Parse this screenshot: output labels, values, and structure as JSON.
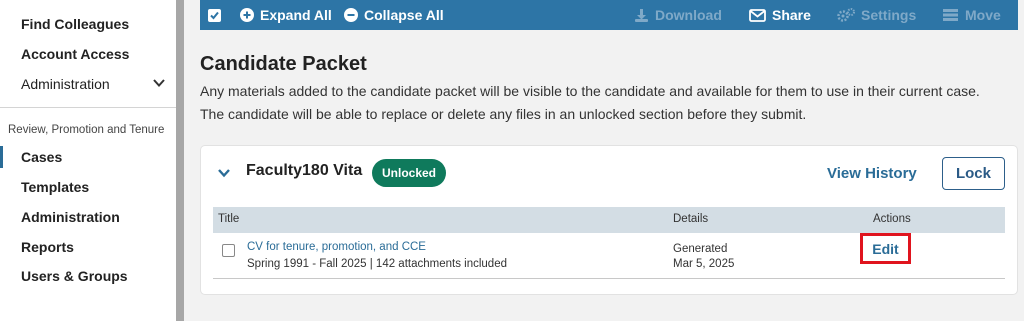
{
  "sidebar": {
    "top_items": [
      {
        "label": "Find Colleagues"
      },
      {
        "label": "Account Access"
      },
      {
        "label": "Administration"
      }
    ],
    "section_label": "Review, Promotion and Tenure",
    "section_items": [
      {
        "label": "Cases",
        "active": true
      },
      {
        "label": "Templates"
      },
      {
        "label": "Administration"
      },
      {
        "label": "Reports"
      },
      {
        "label": "Users & Groups"
      }
    ]
  },
  "toolbar": {
    "expand_all": "Expand All",
    "collapse_all": "Collapse All",
    "download": "Download",
    "share": "Share",
    "settings": "Settings",
    "move": "Move"
  },
  "main": {
    "title": "Candidate Packet",
    "description": "Any materials added to the candidate packet will be visible to the candidate and available for them to use in their current case. The candidate will be able to replace or delete any files in an unlocked section before they submit."
  },
  "section": {
    "title": "Faculty180 Vita",
    "badge": "Unlocked",
    "view_history": "View History",
    "lock": "Lock",
    "table": {
      "headers": {
        "title": "Title",
        "details": "Details",
        "actions": "Actions"
      },
      "rows": [
        {
          "title": "CV for tenure, promotion, and CCE",
          "subtitle": "Spring 1991 - Fall 2025 | 142 attachments included",
          "detail_line1": "Generated",
          "detail_line2": "Mar 5, 2025",
          "action": "Edit"
        }
      ]
    }
  },
  "colors": {
    "toolbar_bg": "#2d75a6",
    "badge_bg": "#0f7a5c",
    "link": "#2a6c97",
    "highlight": "#e0141e"
  }
}
